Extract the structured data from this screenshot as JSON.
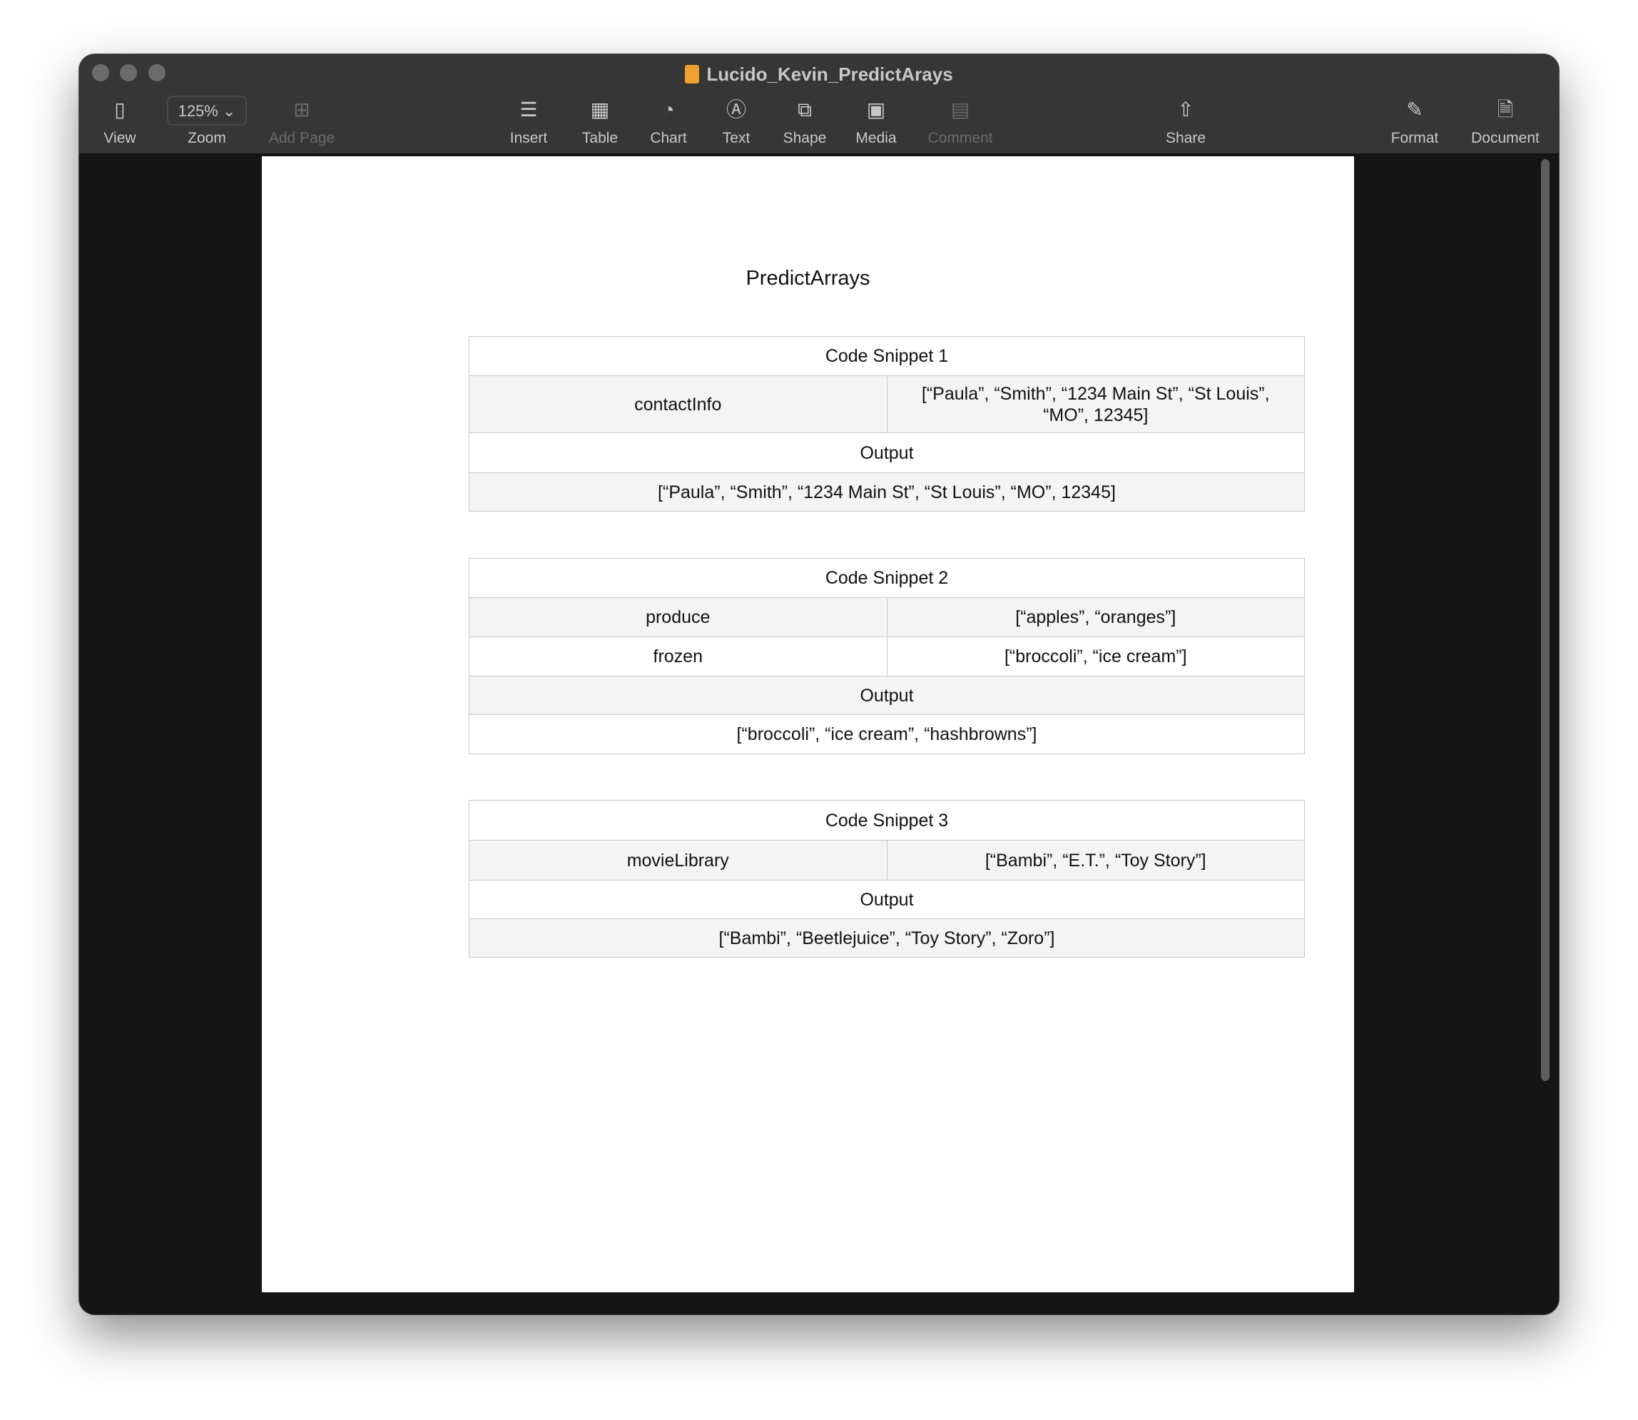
{
  "window": {
    "title": "Lucido_Kevin_PredictArays"
  },
  "toolbar": {
    "view": "View",
    "zoom_value": "125%",
    "zoom": "Zoom",
    "add_page": "Add Page",
    "insert": "Insert",
    "table": "Table",
    "chart": "Chart",
    "text": "Text",
    "shape": "Shape",
    "media": "Media",
    "comment": "Comment",
    "share": "Share",
    "format": "Format",
    "document": "Document"
  },
  "document": {
    "title": "PredictArrays",
    "snippets": [
      {
        "header": "Code Snippet 1",
        "vars": [
          {
            "name": "contactInfo",
            "value": "[“Paula”, “Smith”, “1234 Main St”, “St Louis”, “MO”, 12345]"
          }
        ],
        "output_label": "Output",
        "output": "[“Paula”, “Smith”, “1234 Main St”, “St Louis”, “MO”, 12345]"
      },
      {
        "header": "Code Snippet 2",
        "vars": [
          {
            "name": "produce",
            "value": "[“apples”, “oranges”]"
          },
          {
            "name": "frozen",
            "value": "[“broccoli”, “ice cream”]"
          }
        ],
        "output_label": "Output",
        "output": "[“broccoli”, “ice cream”, “hashbrowns”]"
      },
      {
        "header": "Code Snippet 3",
        "vars": [
          {
            "name": "movieLibrary",
            "value": "[“Bambi”, “E.T.”, “Toy Story”]"
          }
        ],
        "output_label": "Output",
        "output": "[“Bambi”, “Beetlejuice”, “Toy Story”, “Zoro”]"
      }
    ]
  }
}
